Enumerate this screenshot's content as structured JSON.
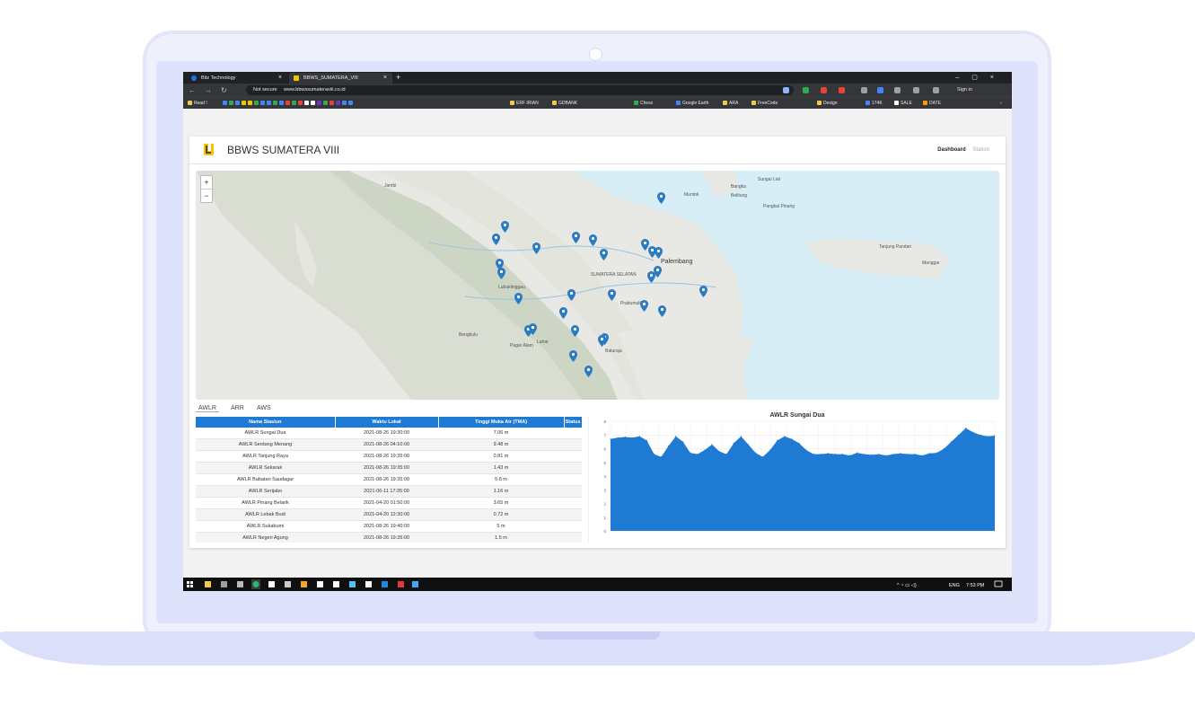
{
  "browser": {
    "tabs": [
      {
        "label": "Bitz Technology",
        "favicon_color": "#1a73e8"
      },
      {
        "label": "BBWS_SUMATERA_VIII",
        "favicon_color": "#f5c400"
      }
    ],
    "security_label": "Not secure",
    "url": "www.bbwssumateraviii.co.id",
    "signin_label": "Sign in",
    "bookmarks": [
      "Read !",
      "ERF IRIAN",
      "GDBANK",
      "Chess",
      "Google Earth",
      "ARA",
      "FreeCode",
      "Design",
      "174K",
      "SALE",
      "DATE"
    ]
  },
  "app": {
    "brand": "BBWS SUMATERA VIII",
    "nav": {
      "dashboard": "Dashboard",
      "station": "Station"
    },
    "colors": {
      "accent": "#1f7ad4",
      "marker": "#2b7bc2",
      "brand_yellow": "#f5c400"
    }
  },
  "map": {
    "zoom_in": "+",
    "zoom_out": "−",
    "labels": [
      "Bangka",
      "Belitung",
      "Sungai Liat",
      "Pangkal Pinang",
      "Muntok",
      "Tanjung Pandan",
      "Manggar",
      "Jambi",
      "Palembang",
      "Lubuklinggau",
      "Bengkulu",
      "Baturaja",
      "Prabumulih",
      "Lahat",
      "Pagar Alam",
      "SUMATERA SELATAN"
    ]
  },
  "station_tabs": [
    "AWLR",
    "ARR",
    "AWS"
  ],
  "table": {
    "headers": [
      "Nama Stasiun",
      "Waktu Lokal",
      "Tinggi Muka Air (TMA)",
      "Status"
    ],
    "rows": [
      [
        "AWLR Sungai Dua",
        "2021-08-26 19:30:00",
        "7.06 m",
        ""
      ],
      [
        "AWLR Serdang Menang",
        "2021-08-26 04:10:00",
        "9.48 m",
        ""
      ],
      [
        "AWLR Tanjung Raya",
        "2021-08-26 19:35:00",
        "0.81 m",
        ""
      ],
      [
        "AWLR Sekarak",
        "2021-08-26 19:35:00",
        "1.43 m",
        ""
      ],
      [
        "AWLR Babatan Saudagar",
        "2021-08-26 19:35:00",
        "5.6 m",
        ""
      ],
      [
        "AWLR Serijabo",
        "2021-06-11 17:35:00",
        "1.16 m",
        ""
      ],
      [
        "AWLR Pinang Belarik",
        "2021-04-20 01:50:00",
        "3.65 m",
        ""
      ],
      [
        "AWLR Lebak Budi",
        "2021-04-20 12:30:00",
        "0.72 m",
        ""
      ],
      [
        "AWLR Sukabumi",
        "2021-08-26 19:40:00",
        "5 m",
        ""
      ],
      [
        "AWLR Negeri Agung",
        "2021-08-26 19:35:00",
        "1.5 m",
        ""
      ]
    ]
  },
  "chart_data": {
    "type": "area",
    "title": "AWLR Sungai Dua",
    "xlabel": "",
    "ylabel": "",
    "ylim": [
      0,
      8
    ],
    "yticks": [
      0,
      1,
      2,
      3,
      4,
      5,
      6,
      7,
      8
    ],
    "grid": true,
    "color": "#1f7ad4",
    "values": [
      6.7,
      6.8,
      6.85,
      6.8,
      6.9,
      6.6,
      5.6,
      5.4,
      6.2,
      6.9,
      6.5,
      5.7,
      5.6,
      5.9,
      6.3,
      5.8,
      5.6,
      6.4,
      6.9,
      6.3,
      5.7,
      5.4,
      5.9,
      6.6,
      6.9,
      6.7,
      6.4,
      5.9,
      5.6,
      5.6,
      5.65,
      5.6,
      5.6,
      5.5,
      5.7,
      5.6,
      5.55,
      5.6,
      5.5,
      5.6,
      5.65,
      5.6,
      5.6,
      5.5,
      5.65,
      5.7,
      6.0,
      6.5,
      7.0,
      7.5,
      7.2,
      7.0,
      6.9,
      6.95
    ]
  },
  "taskbar": {
    "language": "ENG",
    "time": "7:53 PM"
  }
}
